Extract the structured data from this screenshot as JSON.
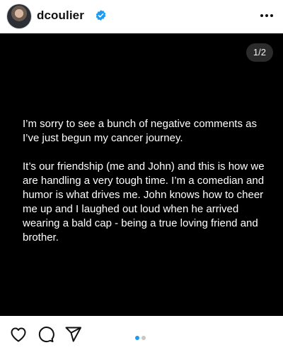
{
  "header": {
    "username": "dcoulier",
    "avatar_icon": "profile-photo",
    "verified_icon": "verified-badge-icon",
    "verified_color": "#1d9bf0",
    "more_icon": "more-horizontal-icon"
  },
  "post": {
    "counter": "1/2",
    "paragraphs": [
      "I’m sorry to see a bunch of negative comments as\nI’ve just begun my cancer journey.",
      "It’s our friendship (me and John) and this is how we\nare handling a very tough time. I’m a comedian and\nhumor is what drives me. John knows how to cheer\nme up and I laughed out loud when he arrived\nwearing a bald cap - being a true loving friend and\nbrother."
    ]
  },
  "actions": {
    "like_icon": "heart-icon",
    "comment_icon": "comment-icon",
    "share_icon": "send-icon",
    "carousel": {
      "count": 2,
      "active_index": 0,
      "active_color": "#1d9bf0",
      "inactive_color": "#c7c7c7"
    }
  }
}
